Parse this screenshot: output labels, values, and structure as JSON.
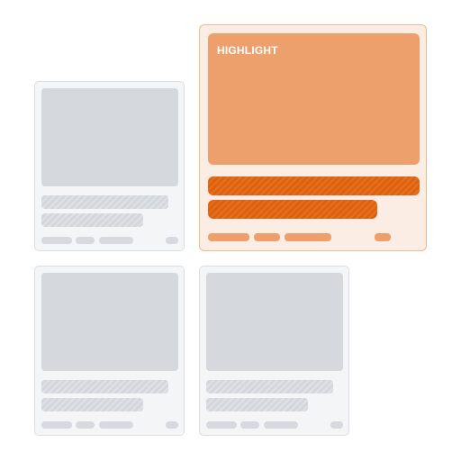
{
  "highlight_card": {
    "label": "HIGHLIGHT"
  },
  "colors": {
    "accent": "#e0610b",
    "accent_light": "#eda06b",
    "accent_bg": "#fbede4",
    "placeholder": "#d5d9dd",
    "card_bg": "#f4f5f6"
  },
  "cards": [
    {
      "id": "card-1",
      "state": "placeholder"
    },
    {
      "id": "card-2",
      "state": "highlighted"
    },
    {
      "id": "card-3",
      "state": "placeholder"
    },
    {
      "id": "card-4",
      "state": "placeholder"
    }
  ]
}
